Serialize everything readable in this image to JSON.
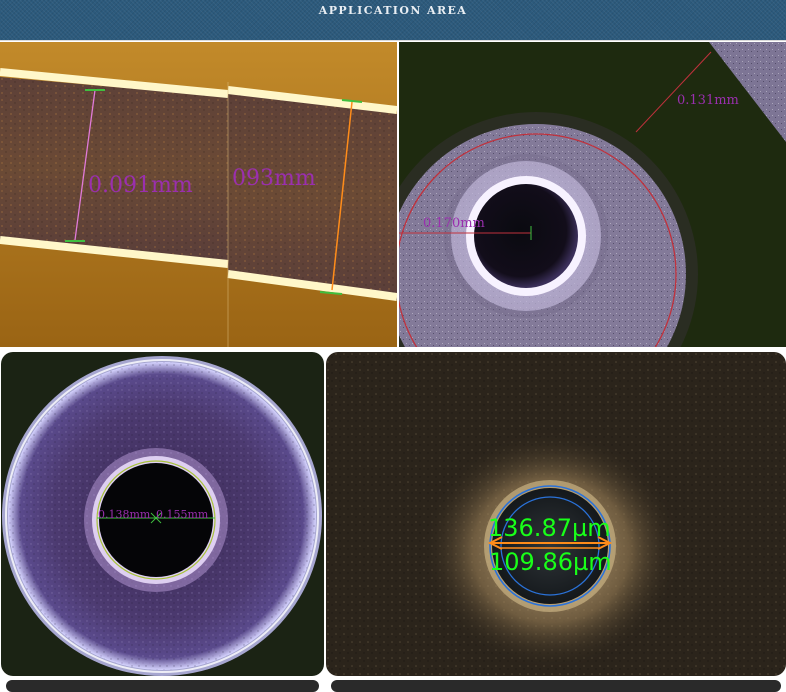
{
  "header": {
    "title": "APPLICATION AREA"
  },
  "gallery": {
    "p1": {
      "left_measure": "0.091mm",
      "right_measure": "093mm"
    },
    "p2": {
      "outer_measure": "0.131mm",
      "inner_measure": "0.170mm"
    },
    "p3": {
      "left_measure": "0.138mm",
      "right_measure": "0.155mm"
    },
    "p4": {
      "outer_measure": "136.87µm",
      "inner_measure": "109.86µm"
    }
  },
  "colors": {
    "header_bg": "#2c5a7c",
    "copper": "#b27a1c",
    "measure_magenta": "#9a2fae",
    "measure_green": "#19ff19",
    "measure_orange": "#ff8c1a"
  }
}
